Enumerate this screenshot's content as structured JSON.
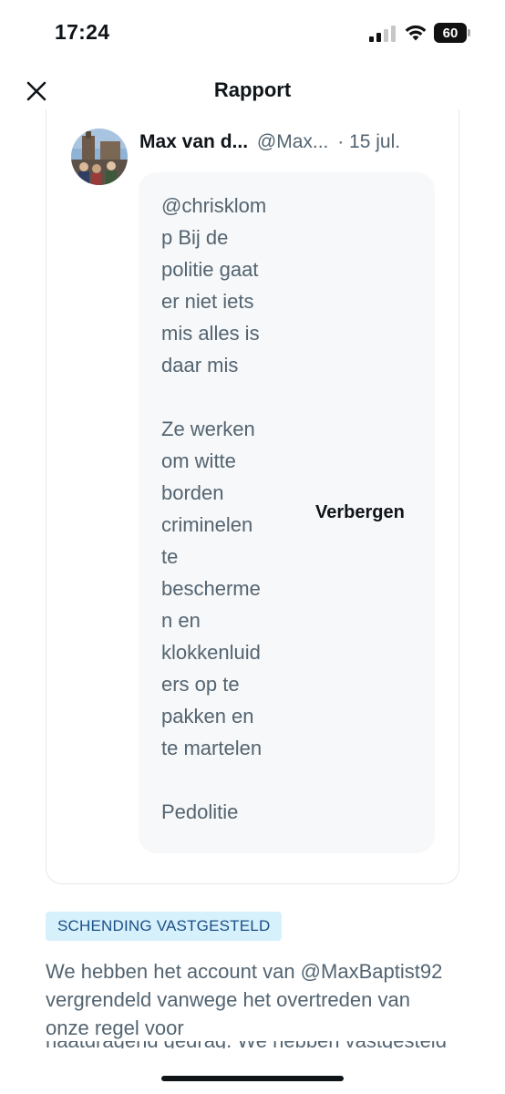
{
  "status_bar": {
    "time": "17:24",
    "battery": "60",
    "signal_icon": "cellular-signal-icon",
    "wifi_icon": "wifi-icon"
  },
  "header": {
    "title": "Rapport",
    "close_icon": "close-icon"
  },
  "tweet": {
    "author_name": "Max van d...",
    "author_handle": "@Max...",
    "date": "· 15 jul.",
    "text": "@chrisklom\np Bij de\npolitie gaat\ner niet iets\nmis alles is\ndaar mis\n\nZe werken\nom witte\nborden\ncriminelen\nte\nbescherme\nn en\nklokkenluid\ners op te\npakken en\nte martelen\n\nPedolitie",
    "hide_label": "Verbergen"
  },
  "violation": {
    "badge": "SCHENDING VASTGESTELD",
    "text": "We hebben het account van @MaxBaptist92 vergrendeld vanwege het overtreden van onze regel voor",
    "cut_line": "haatdragend gedrag. We hebben vastgesteld"
  },
  "colors": {
    "primary_text": "#0f1419",
    "secondary_text": "#536471",
    "badge_bg": "#d6f0fc",
    "badge_text": "#1b4f86",
    "hidden_bg": "#f7f8f9"
  }
}
